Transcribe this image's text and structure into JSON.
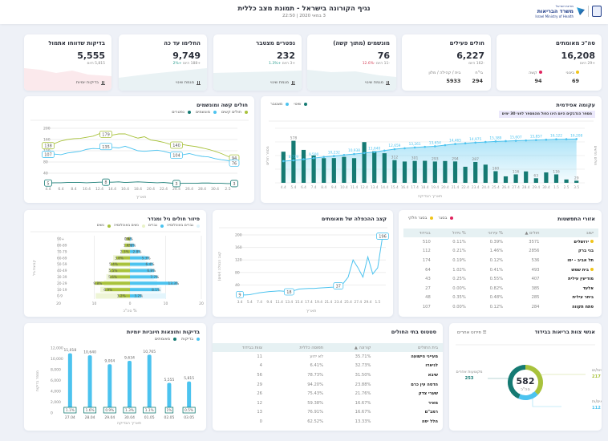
{
  "header": {
    "title": "נגיף הקורונה בישראל - תמונת מצב כללית",
    "date": "3 במאי 2020 | 22:50",
    "logo_top": "מדינת ישראל",
    "logo_name": "משרד הבריאות",
    "logo_en": "Israel Ministry of Health"
  },
  "kpis": [
    {
      "title": "סה\"כ מאומתים",
      "value": "16,208",
      "sub": "+29 היום",
      "details": [
        {
          "label": "בינוני",
          "value": "69",
          "color": "#f0c419"
        },
        {
          "label": "קשה",
          "value": "94",
          "color": "#e0245e"
        }
      ]
    },
    {
      "title": "חולים פעילים",
      "value": "6,227",
      "sub": "-162 היום",
      "details": [
        {
          "label": "בי\"ח",
          "value": "294"
        },
        {
          "label": "בית / קהילה / מלון",
          "value": "5933"
        }
      ]
    },
    {
      "title": "מונשמים (מתוך קשה)",
      "value": "76",
      "sub": "-11 היום",
      "change": "-12.6%",
      "link": "מגמת שינוי"
    },
    {
      "title": "נפטרים מצטבר",
      "value": "232",
      "sub": "+3 היום",
      "change": "+1.3%",
      "link": "מגמת שינוי"
    },
    {
      "title": "החלימו עד כה",
      "value": "9,749",
      "sub": "+188 היום",
      "change": "+2%",
      "link": "מגמת שינוי"
    },
    {
      "title": "בדיקות שדווחו אתמול",
      "value": "5,555",
      "sub": "5,815 היום",
      "link": "בדיקות יומיות"
    }
  ],
  "epi": {
    "title": "עקומה אפידמית",
    "note": "מספר הנדבקים היום הינו כפול מהמספר לפני 30 ימים",
    "legend": [
      "שינוי",
      "מצטבר"
    ],
    "ylabel_left": "מספר חולים",
    "ylabel_right": "חולים חדשים",
    "xlabel": "תאריך הבדיקה"
  },
  "severe": {
    "title": "חולים קשה ומונשמים",
    "legend": [
      "חולים קשים",
      "מונשמים",
      "נפטרים"
    ],
    "xlabel": "תאריך"
  },
  "doubling": {
    "title": "קצב ההכפלה של מאומתים",
    "ylabel": "קצב הכפלה (ימים)",
    "xlabel": "תאריך"
  },
  "age": {
    "title": "פיזור חולים גיל ומגדר",
    "legend": [
      "גברים באוכלוסיה",
      "גברים",
      "נשים באוכלוסיה",
      "נשים"
    ],
    "ylabel": "קבוצת גיל",
    "xlabel": "% סה\"כ"
  },
  "areas": {
    "title": "אזורי התפשטות",
    "legend": [
      "בסגר",
      "בסגר חלקי"
    ],
    "columns": [
      "ישוב",
      "חולים ▲",
      "% עירוני",
      "% גידול",
      "בבידוד"
    ],
    "rows": [
      [
        "ירושלים",
        "3571",
        "0.39%",
        "0.11%",
        "510",
        "partial"
      ],
      [
        "בני ברק",
        "2856",
        "1.46%",
        "0.21%",
        "112",
        ""
      ],
      [
        "תל אביב - יפו",
        "536",
        "0.12%",
        "0.19%",
        "174",
        ""
      ],
      [
        "בית שמש",
        "493",
        "0.41%",
        "1.02%",
        "64",
        "partial"
      ],
      [
        "מודיעין עילית",
        "407",
        "0.55%",
        "0.25%",
        "43",
        ""
      ],
      [
        "אלעד",
        "385",
        "0.82%",
        "0.00%",
        "27",
        ""
      ],
      [
        "ביתר עילית",
        "285",
        "0.48%",
        "0.35%",
        "48",
        ""
      ],
      [
        "פתח תקווה",
        "284",
        "0.12%",
        "0.00%",
        "107",
        ""
      ]
    ]
  },
  "tests": {
    "title": "בדיקות ותוצאות חיוביות יומיות",
    "legend": [
      "בדיקות",
      "מאומתים"
    ],
    "ylabel": "מספר בדיקות",
    "xlabel": "תאריך הבדיקה"
  },
  "hospitals": {
    "title": "סטטוס בתי החולים",
    "columns": [
      "בית החולים",
      "קורונה ▲",
      "תפוסה כללית",
      "צוות בבידוד"
    ],
    "rows": [
      [
        "מעייני הישועה",
        "35.71%",
        "לא ידוע",
        "11"
      ],
      [
        "לניאדו",
        "32.73%",
        "6.41%",
        "4"
      ],
      [
        "שיבא",
        "31.50%",
        "78.73%",
        "56"
      ],
      [
        "הדסה עין כרם",
        "23.88%",
        "94.20%",
        "29"
      ],
      [
        "שערי צדק",
        "21.76%",
        "75.43%",
        "26"
      ],
      [
        "מאיר",
        "16.67%",
        "59.38%",
        "12"
      ],
      [
        "רמב\"ם",
        "16.67%",
        "76.91%",
        "13"
      ],
      [
        "הלל יפה",
        "13.33%",
        "62.52%",
        "0"
      ]
    ]
  },
  "staff": {
    "title": "אנשי צוות בריאות בבידוד",
    "button": "פירוט אחרים",
    "total": "582",
    "total_label": "סה\"כ",
    "segments": [
      {
        "label": "אחיות/ים",
        "value": 217,
        "color": "#a8c23c"
      },
      {
        "label": "רופאים/ות",
        "value": 112,
        "color": "#4cc3ef"
      },
      {
        "label": "מקצועות אחרים",
        "value": 253,
        "color": "#157a73"
      }
    ]
  },
  "colors": {
    "teal": "#157a73",
    "blue": "#4cc3ef",
    "green": "#a8c23c",
    "red": "#e0245e",
    "yellow": "#f0c419"
  },
  "chart_data": [
    {
      "id": "epi",
      "type": "bar+line",
      "x": [
        "4.4",
        "5.4",
        "6.4",
        "7.4",
        "8.4",
        "9.4",
        "10.4",
        "11.4",
        "12.4",
        "13.4",
        "14.4",
        "15.4",
        "16.4",
        "17.4",
        "18.4",
        "19.4",
        "20.4",
        "21.4",
        "22.4",
        "23.4",
        "24.4",
        "25.4",
        "26.4",
        "27.4",
        "28.4",
        "29.4",
        "30.4",
        "1.5",
        "2.5",
        "3.5"
      ],
      "series": [
        {
          "name": "שינוי",
          "type": "bar",
          "values": [
            428,
            578,
            453,
            375,
            339,
            340,
            357,
            339,
            560,
            435,
            407,
            312,
            293,
            301,
            303,
            293,
            300,
            294,
            221,
            287,
            250,
            160,
            89,
            116,
            157,
            63,
            143,
            116,
            46,
            29
          ]
        },
        {
          "name": "מצטבר",
          "type": "line",
          "values": [
            8430,
            8719,
            9100,
            9500,
            9900,
            10232,
            10600,
            10938,
            11300,
            11640,
            12150,
            12659,
            12960,
            13261,
            13460,
            13654,
            14060,
            14465,
            14720,
            14975,
            15180,
            15389,
            15500,
            15607,
            15730,
            15857,
            15990,
            16122,
            16170,
            16208
          ]
        }
      ],
      "bar_labels_at": [
        "5.4",
        "15.4",
        "17.4",
        "19.4",
        "21.4",
        "23.4",
        "25.4",
        "27.4",
        "29.4",
        "1.5",
        "3.5"
      ],
      "ylim_bar": [
        0,
        750
      ],
      "ylim_line": [
        800,
        20000
      ]
    },
    {
      "id": "severe",
      "type": "line",
      "x": [
        "4.4",
        "5.4",
        "6.4",
        "7.4",
        "8.4",
        "9.4",
        "10.4",
        "11.4",
        "12.4",
        "13.4",
        "14.4",
        "15.4",
        "16.4",
        "17.4",
        "18.4",
        "19.4",
        "20.4",
        "21.4",
        "22.4",
        "23.4",
        "24.4",
        "25.4",
        "26.4",
        "27.4",
        "28.4",
        "29.4",
        "30.4",
        "1.5",
        "2.5",
        "3.5"
      ],
      "xticks": [
        "4.4",
        "6.4",
        "8.4",
        "10.4",
        "12.4",
        "14.4",
        "16.4",
        "18.4",
        "20.4",
        "22.4",
        "24.4",
        "26.4",
        "28.4",
        "30.4",
        "2.5"
      ],
      "ylim": [
        0,
        200
      ],
      "yticks": [
        40,
        80,
        120,
        160,
        200
      ],
      "series": [
        {
          "name": "חולים קשים",
          "values": [
            138,
            146,
            155,
            160,
            163,
            164,
            168,
            172,
            181,
            179,
            176,
            180,
            180,
            172,
            165,
            170,
            158,
            155,
            150,
            143,
            140,
            142,
            138,
            135,
            130,
            125,
            118,
            110,
            100,
            94
          ]
        },
        {
          "name": "מונשמים",
          "values": [
            107,
            108,
            106,
            112,
            115,
            118,
            125,
            128,
            127,
            135,
            132,
            130,
            136,
            128,
            120,
            118,
            120,
            122,
            118,
            112,
            104,
            106,
            110,
            104,
            100,
            98,
            92,
            88,
            85,
            76
          ]
        },
        {
          "name": "נפטרים",
          "values": [
            5,
            6,
            6,
            7,
            7,
            7,
            6,
            7,
            8,
            8,
            8,
            9,
            7,
            8,
            9,
            8,
            7,
            6,
            7,
            5,
            3,
            4,
            4,
            4,
            5,
            5,
            4,
            4,
            3,
            3
          ]
        }
      ],
      "labels_at": [
        "4.4",
        "13.4",
        "24.4",
        "3.5"
      ]
    },
    {
      "id": "doubling",
      "type": "line",
      "x": [
        "3.4",
        "4.4",
        "5.4",
        "6.4",
        "7.4",
        "8.4",
        "9.4",
        "10.4",
        "11.4",
        "12.4",
        "13.4",
        "14.4",
        "15.4",
        "16.4",
        "17.4",
        "18.4",
        "19.4",
        "20.4",
        "21.4",
        "22.4",
        "23.4",
        "24.4",
        "25.4",
        "26.4",
        "27.4",
        "28.4",
        "29.4",
        "30.4",
        "1.5",
        "2.5"
      ],
      "xticks": [
        "3.4",
        "5.4",
        "7.4",
        "9.4",
        "11.4",
        "13.4",
        "15.4",
        "17.4",
        "19.4",
        "21.4",
        "23.4",
        "25.4",
        "27.4",
        "29.4",
        "1.5"
      ],
      "ylim": [
        0,
        200
      ],
      "yticks": [
        40,
        80,
        120,
        160,
        200
      ],
      "values": [
        9,
        8,
        9,
        12,
        15,
        17,
        19,
        20,
        21,
        20,
        18,
        22,
        27,
        28,
        29,
        29,
        30,
        31,
        32,
        33,
        37,
        45,
        65,
        120,
        95,
        65,
        130,
        75,
        95,
        196
      ],
      "labels_at": [
        "3.4",
        "13.4",
        "23.4",
        "2.5"
      ]
    },
    {
      "id": "age",
      "type": "bar",
      "orientation": "horizontal-pyramid",
      "categories": [
        "0-9",
        "10-19",
        "20-29",
        "30-39",
        "40-49",
        "50-59",
        "60-69",
        "70-79",
        "80-89",
        "+90"
      ],
      "xlim": [
        -20,
        20
      ],
      "xticks": [
        -20,
        -10,
        0,
        10,
        20
      ],
      "series": [
        {
          "name": "נשים",
          "values": [
            3.2,
            6.9,
            9.8,
            5.6,
            5.5,
            5.4,
            3.8,
            2.3,
            1.4,
            1
          ]
        },
        {
          "name": "גברים",
          "values": [
            3.2,
            8.1,
            13.3,
            7.7,
            6.8,
            6.4,
            5.3,
            2.8,
            1.2,
            0.4
          ]
        },
        {
          "name": "נשים באוכלוסיה",
          "values": [
            9.6,
            8.3,
            7.3,
            6.6,
            6.0,
            5.0,
            4.7,
            2.7,
            1.5,
            0.4
          ]
        },
        {
          "name": "גברים באוכלוסיה",
          "values": [
            10.1,
            8.8,
            7.6,
            6.7,
            6.0,
            4.8,
            4.3,
            2.2,
            1.0,
            0.2
          ]
        }
      ],
      "labels": {
        "נשים": [
          "3.2%",
          "6.9%",
          "9.8%",
          "5.6%",
          "5.5%",
          "5.4%",
          "3.8%",
          "2.3%",
          "1.4%",
          "1%"
        ],
        "גברים": [
          "3.2%",
          "8.1%",
          "13.3%",
          "7.7%",
          "6.8%",
          "6.4%",
          "5.3%",
          "2.8%",
          "1.2%",
          "0.4%"
        ]
      }
    },
    {
      "id": "tests",
      "type": "bar",
      "categories": [
        "27.04",
        "28.04",
        "29.04",
        "30.04",
        "01.05",
        "02.05",
        "03.05"
      ],
      "ylim": [
        0,
        12000
      ],
      "yticks": [
        "0",
        "2,000",
        "4,000",
        "6,000",
        "8,000",
        "10,000",
        "12,000"
      ],
      "series": [
        {
          "name": "בדיקות",
          "values": [
            11018,
            10640,
            9004,
            9634,
            10765,
            5555,
            5815
          ],
          "labels": [
            "11,018",
            "10,640",
            "9,004",
            "9,634",
            "10,765",
            "5,555",
            "5,815"
          ]
        },
        {
          "name": "מאומתים",
          "values": [
            "1.1%",
            "1.6%",
            "0.9%",
            "1.3%",
            "1.1%",
            "1%",
            "0.5%"
          ]
        }
      ]
    }
  ]
}
